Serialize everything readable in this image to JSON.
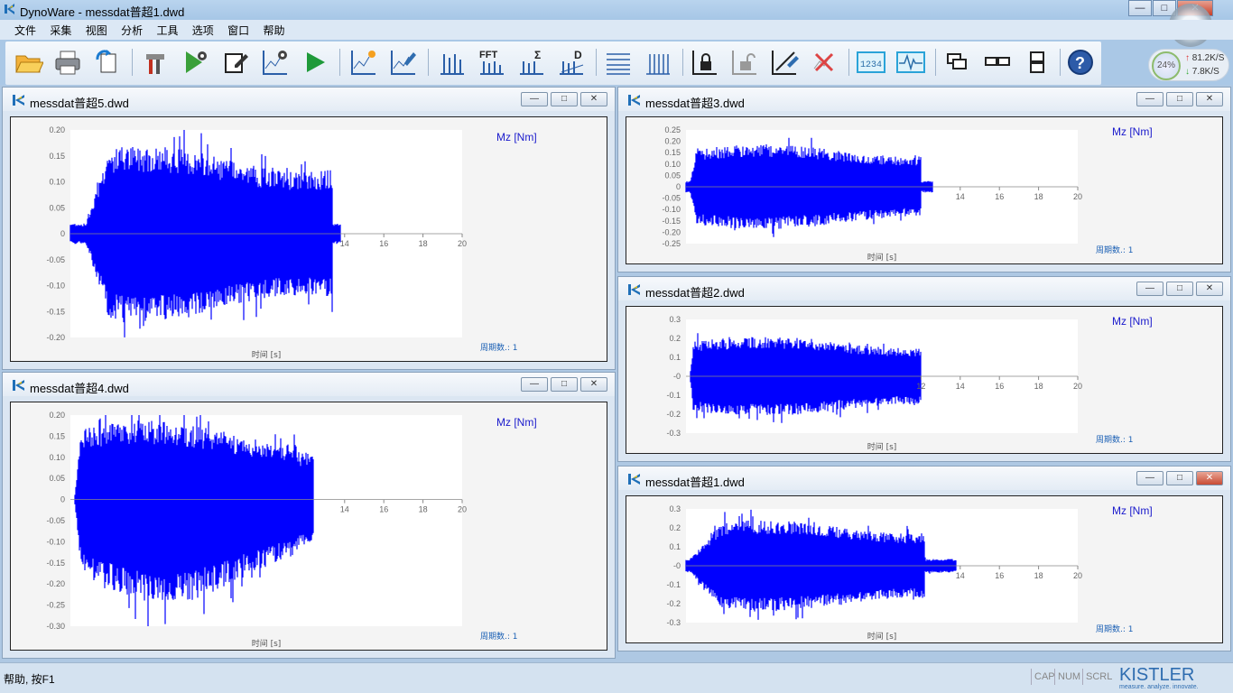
{
  "window": {
    "title": "DynoWare - messdat普超1.dwd",
    "controls": [
      "—",
      "□",
      "✕"
    ]
  },
  "menu": [
    "文件",
    "采集",
    "视图",
    "分析",
    "工具",
    "选项",
    "窗口",
    "帮助"
  ],
  "toolbar": {
    "buttons": [
      "open-icon",
      "print-icon",
      "export-icon",
      "tools-icon",
      "acquire-setup-icon",
      "edit-icon",
      "graph-setup-icon",
      "start-icon",
      "cursor-icon",
      "draw-icon",
      "filter-icon",
      "fft-icon",
      "sum-icon",
      "drift-icon",
      "grid-h-icon",
      "grid-v-icon",
      "lock-icon",
      "unlock-icon",
      "zoom-icon",
      "delete-curve-icon",
      "numeric-display-icon",
      "oscilloscope-icon",
      "cascade-icon",
      "tile-h-icon",
      "tile-v-icon",
      "help-icon"
    ],
    "fft_label": "FFT",
    "sum_label": "Σ",
    "drift_label": "D",
    "numeric_label": "1234"
  },
  "network_widget": {
    "percent": "24%",
    "upload": "81.2K/S",
    "download": "7.8K/S"
  },
  "colors": {
    "signal": "#0000ff",
    "label_blue": "#1a5fb4",
    "mdi_bg": "#aec8e3"
  },
  "windows": [
    {
      "title": "messdat普超5.dwd",
      "channel": "Mz [Nm]",
      "xlabel": "时间 [s]",
      "cycles": "周期数.: 1",
      "x_ticks": [
        "14",
        "16",
        "18",
        "20"
      ],
      "y_ticks": [
        "0.20",
        "0.15",
        "0.10",
        "0.05",
        "0",
        "-0.05",
        "-0.10",
        "-0.15",
        "-0.20"
      ]
    },
    {
      "title": "messdat普超4.dwd",
      "channel": "Mz [Nm]",
      "xlabel": "时间 [s]",
      "cycles": "周期数.: 1",
      "x_ticks": [
        "14",
        "16",
        "18",
        "20"
      ],
      "y_ticks": [
        "0.20",
        "0.15",
        "0.10",
        "0.05",
        "0",
        "-0.05",
        "-0.10",
        "-0.15",
        "-0.20",
        "-0.25",
        "-0.30"
      ]
    },
    {
      "title": "messdat普超3.dwd",
      "channel": "Mz [Nm]",
      "xlabel": "时间 [s]",
      "cycles": "周期数.: 1",
      "x_ticks": [
        "14",
        "16",
        "18",
        "20"
      ],
      "y_ticks": [
        "0.25",
        "0.20",
        "0.15",
        "0.10",
        "0.05",
        "0",
        "-0.05",
        "-0.10",
        "-0.15",
        "-0.20",
        "-0.25"
      ]
    },
    {
      "title": "messdat普超2.dwd",
      "channel": "Mz [Nm]",
      "xlabel": "时间 [s]",
      "cycles": "周期数.: 1",
      "x_ticks": [
        "12",
        "14",
        "16",
        "18",
        "20"
      ],
      "y_ticks": [
        "0.3",
        "0.2",
        "0.1",
        "-0",
        "-0.1",
        "-0.2",
        "-0.3"
      ]
    },
    {
      "title": "messdat普超1.dwd",
      "channel": "Mz [Nm]",
      "xlabel": "时间 [s]",
      "cycles": "周期数.: 1",
      "x_ticks": [
        "14",
        "16",
        "18",
        "20"
      ],
      "y_ticks": [
        "0.3",
        "0.2",
        "0.1",
        "-0",
        "-0.1",
        "-0.2",
        "-0.3"
      ]
    }
  ],
  "status": {
    "help": "帮助, 按F1",
    "cap": "CAP",
    "num": "NUM",
    "scrl": "SCRL"
  },
  "logo": {
    "name": "KISTLER",
    "tagline": "measure. analyze. innovate."
  }
}
